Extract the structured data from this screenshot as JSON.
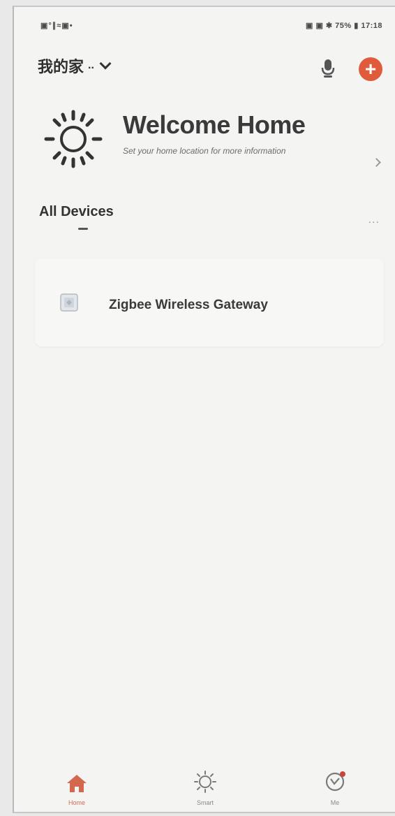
{
  "status_bar": {
    "left_icons": "▣°∥≈▣•",
    "right_text": "▣ ▣ ✱ 75% ▮ 17:18"
  },
  "header": {
    "home_name": "我的家",
    "home_suffix": "..",
    "mic_icon": "mic-icon",
    "add_icon": "plus-circle-icon",
    "add_symbol": "+",
    "accent_color": "#e05a3c"
  },
  "welcome": {
    "title": "Welcome Home",
    "subtitle": "Set your home location for more information"
  },
  "devices": {
    "section_title": "All Devices",
    "more": "...",
    "items": [
      {
        "name": "Zigbee Wireless Gateway",
        "icon": "gateway-icon"
      }
    ]
  },
  "bottom_nav": {
    "items": [
      {
        "label": "Home",
        "icon": "home-icon",
        "active": true
      },
      {
        "label": "Smart",
        "icon": "smart-sun-icon",
        "active": false
      },
      {
        "label": "Me",
        "icon": "me-icon",
        "active": false
      }
    ],
    "active_color": "#d4684e"
  }
}
